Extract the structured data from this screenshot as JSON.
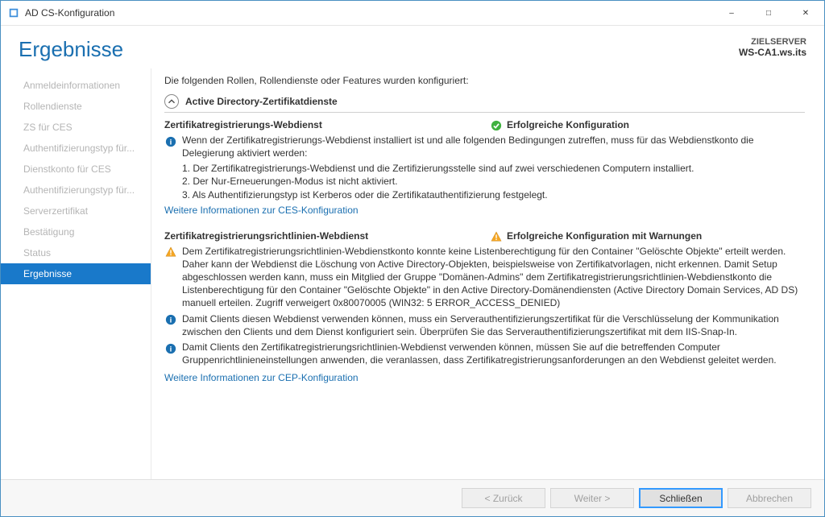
{
  "window": {
    "title": "AD CS-Konfiguration"
  },
  "header": {
    "page_title": "Ergebnisse",
    "target_label": "ZIELSERVER",
    "target_name": "WS-CA1.ws.its"
  },
  "sidebar": {
    "items": [
      {
        "label": "Anmeldeinformationen"
      },
      {
        "label": "Rollendienste"
      },
      {
        "label": "ZS für CES"
      },
      {
        "label": "Authentifizierungstyp für..."
      },
      {
        "label": "Dienstkonto für CES"
      },
      {
        "label": "Authentifizierungstyp für..."
      },
      {
        "label": "Serverzertifikat"
      },
      {
        "label": "Bestätigung"
      },
      {
        "label": "Status"
      },
      {
        "label": "Ergebnisse"
      }
    ],
    "active_index": 9
  },
  "content": {
    "intro": "Die folgenden Rollen, Rollendienste oder Features wurden konfiguriert:",
    "expander": {
      "label": "Active Directory-Zertifikatdienste"
    },
    "section1": {
      "title": "Zertifikatregistrierungs-Webdienst",
      "status": "Erfolgreiche Konfiguration",
      "info": "Wenn der Zertifikatregistrierungs-Webdienst installiert ist und alle folgenden Bedingungen zutreffen, muss für das Webdienstkonto die Delegierung aktiviert werden:",
      "ol1": "1. Der Zertifikatregistrierungs-Webdienst und die Zertifizierungsstelle sind auf zwei verschiedenen Computern installiert.",
      "ol2": "2. Der Nur-Erneuerungen-Modus ist nicht aktiviert.",
      "ol3": "3. Als Authentifizierungstyp ist Kerberos oder die Zertifikatauthentifizierung festgelegt.",
      "link": "Weitere Informationen zur CES-Konfiguration"
    },
    "section2": {
      "title": "Zertifikatregistrierungsrichtlinien-Webdienst",
      "status": "Erfolgreiche Konfiguration mit Warnungen",
      "warn": "Dem Zertifikatregistrierungsrichtlinien-Webdienstkonto konnte keine Listenberechtigung für den Container \"Gelöschte Objekte\" erteilt werden. Daher kann der Webdienst die Löschung von Active Directory-Objekten, beispielsweise von Zertifikatvorlagen, nicht erkennen. Damit Setup abgeschlossen werden kann, muss ein Mitglied der Gruppe \"Domänen-Admins\" dem Zertifikatregistrierungsrichtlinien-Webdienstkonto die Listenberechtigung für den Container \"Gelöschte Objekte\" in den Active Directory-Domänendiensten (Active Directory Domain Services, AD DS) manuell erteilen. Zugriff verweigert 0x80070005 (WIN32: 5 ERROR_ACCESS_DENIED)",
      "info1": "Damit Clients diesen Webdienst verwenden können, muss ein Serverauthentifizierungszertifikat für die Verschlüsselung der Kommunikation zwischen den Clients und dem Dienst konfiguriert sein. Überprüfen Sie das Serverauthentifizierungszertifikat mit dem IIS-Snap-In.",
      "info2": "Damit Clients den Zertifikatregistrierungsrichtlinien-Webdienst verwenden können, müssen Sie auf die betreffenden Computer Gruppenrichtlinieneinstellungen anwenden, die veranlassen, dass Zertifikatregistrierungsanforderungen an den Webdienst geleitet werden.",
      "link": "Weitere Informationen zur CEP-Konfiguration"
    }
  },
  "footer": {
    "back": "< Zurück",
    "next": "Weiter >",
    "close": "Schließen",
    "cancel": "Abbrechen"
  }
}
